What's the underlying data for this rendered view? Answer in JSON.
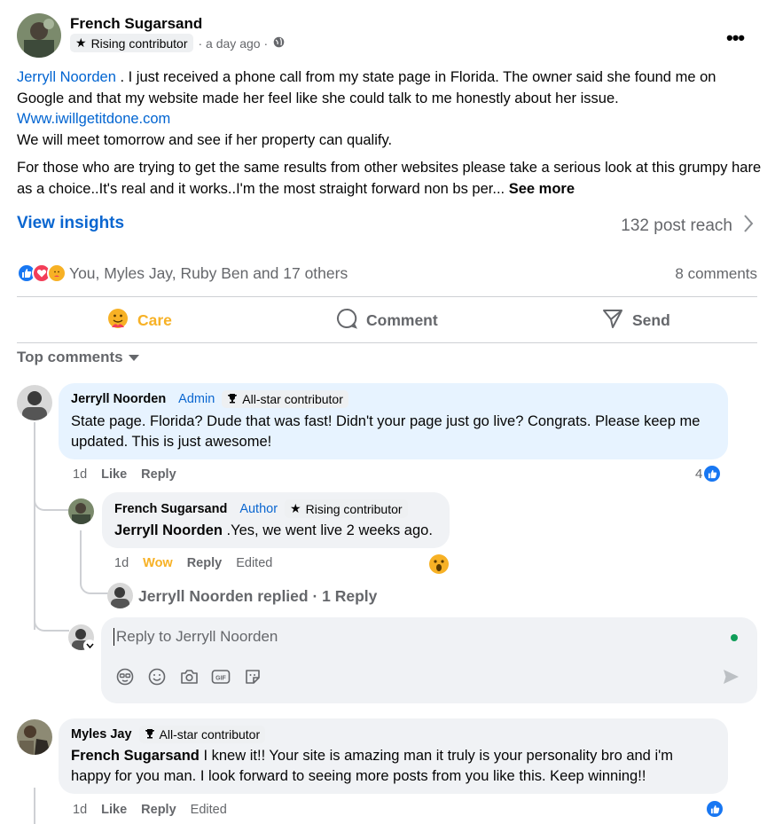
{
  "post": {
    "author": "French Sugarsand",
    "badge": "Rising contributor",
    "time": "· a day ago ·",
    "paragraph1_link": "Jerryll Noorden",
    "paragraph1_text": " . I just received a phone call from my state page in Florida. The owner said she found me on Google and that my website made her feel like she could talk to me honestly about her issue.",
    "website": "Www.iwillgetitdone.com",
    "paragraph2": "We will meet tomorrow and see if her property can qualify.",
    "paragraph3": "For those who are trying to get the same results from other websites please take a serious look at this grumpy hare as a choice..It's real and it works..I'm the most straight forward non bs per...",
    "see_more": "See more",
    "insights": "View insights",
    "reach": "132 post reach",
    "reactions_text": "You, Myles Jay, Ruby Ben and 17 others",
    "comments_count": "8 comments"
  },
  "actions": {
    "care": "Care",
    "comment": "Comment",
    "send": "Send"
  },
  "top_comments_label": "Top comments",
  "comments": [
    {
      "name": "Jerryll Noorden",
      "role": "Admin",
      "badge": "All-star contributor",
      "text": "State page. Florida? Dude that was fast! Didn't your page just go live? Congrats. Please keep me updated. This is just awesome!",
      "time": "1d",
      "like": "Like",
      "reply": "Reply",
      "like_count": "4"
    },
    {
      "name": "French Sugarsand",
      "role": "Author",
      "badge": "Rising contributor",
      "mention": "Jerryll Noorden",
      "text": " .Yes, we went live 2 weeks ago.",
      "time": "1d",
      "reaction": "Wow",
      "reply": "Reply",
      "edited": "Edited"
    },
    {
      "name": "Myles Jay",
      "badge": "All-star contributor",
      "mention": "French Sugarsand",
      "text": " I knew it!! Your site is amazing man it truly is your personality bro and i'm happy for you man. I look forward to seeing more posts from you like this. Keep winning!!",
      "time": "1d",
      "like": "Like",
      "reply": "Reply",
      "edited": "Edited"
    }
  ],
  "replied_summary": "Jerryll Noorden replied · 1 Reply",
  "reply_box": {
    "placeholder": "Reply to Jerryll Noorden"
  },
  "colors": {
    "link": "#0064d1",
    "care": "#f7b125",
    "comment_bubble": "#e7f3ff"
  }
}
